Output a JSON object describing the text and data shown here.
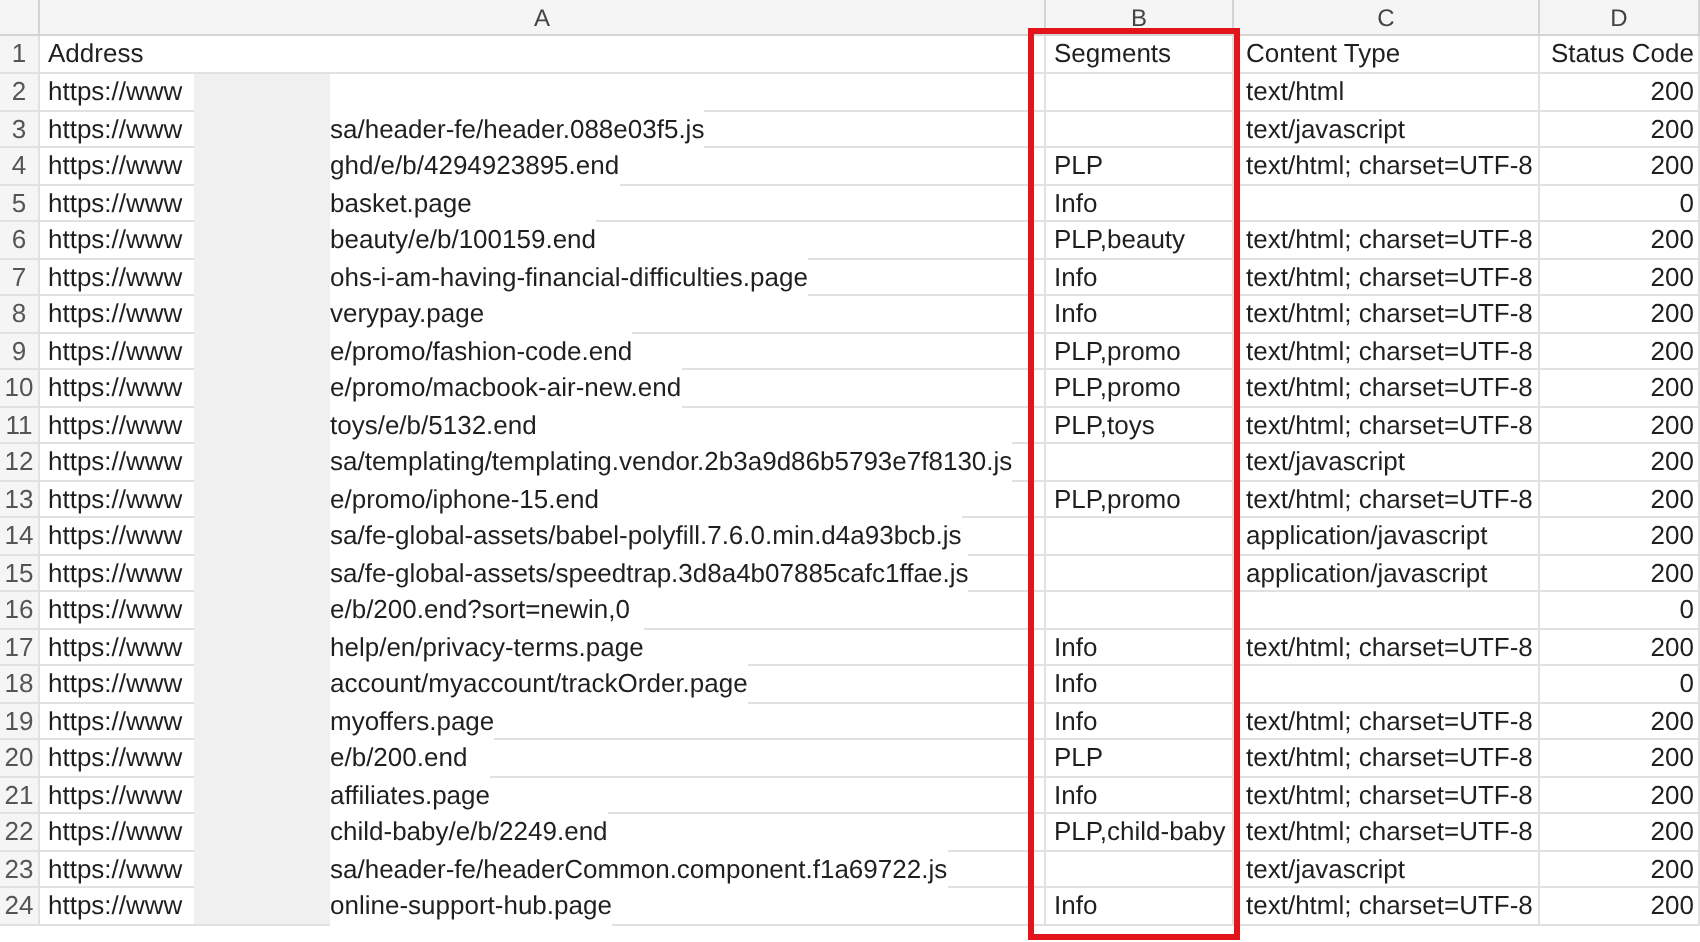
{
  "columns": [
    "A",
    "B",
    "C",
    "D"
  ],
  "header_row": {
    "row_number": "1",
    "address": "Address",
    "segments": "Segments",
    "content_type": "Content Type",
    "status_code": "Status Code"
  },
  "rows": [
    {
      "row_number": "2",
      "address_prefix": "https://www",
      "content_type": "text/html",
      "status_code": "200"
    },
    {
      "row_number": "3",
      "address_prefix": "https://www",
      "address_path": "sa/header-fe/header.088e03f5.js",
      "content_type": "text/javascript",
      "status_code": "200"
    },
    {
      "row_number": "4",
      "address_prefix": "https://www",
      "address_path": "ghd/e/b/4294923895.end",
      "segments": "PLP",
      "content_type": "text/html; charset=UTF-8",
      "status_code": "200"
    },
    {
      "row_number": "5",
      "address_prefix": "https://www",
      "address_path": "basket.page",
      "segments": "Info",
      "status_code": "0"
    },
    {
      "row_number": "6",
      "address_prefix": "https://www",
      "address_path": "beauty/e/b/100159.end",
      "segments": "PLP,beauty",
      "content_type": "text/html; charset=UTF-8",
      "status_code": "200"
    },
    {
      "row_number": "7",
      "address_prefix": "https://www",
      "address_path": "ohs-i-am-having-financial-difficulties.page",
      "segments": "Info",
      "content_type": "text/html; charset=UTF-8",
      "status_code": "200"
    },
    {
      "row_number": "8",
      "address_prefix": "https://www",
      "address_path": "verypay.page",
      "segments": "Info",
      "content_type": "text/html; charset=UTF-8",
      "status_code": "200"
    },
    {
      "row_number": "9",
      "address_prefix": "https://www",
      "address_path": "e/promo/fashion-code.end",
      "segments": "PLP,promo",
      "content_type": "text/html; charset=UTF-8",
      "status_code": "200"
    },
    {
      "row_number": "10",
      "address_prefix": "https://www",
      "address_path": "e/promo/macbook-air-new.end",
      "segments": "PLP,promo",
      "content_type": "text/html; charset=UTF-8",
      "status_code": "200"
    },
    {
      "row_number": "11",
      "address_prefix": "https://www",
      "address_path": "toys/e/b/5132.end",
      "segments": "PLP,toys",
      "content_type": "text/html; charset=UTF-8",
      "status_code": "200"
    },
    {
      "row_number": "12",
      "address_prefix": "https://www",
      "address_path": "sa/templating/templating.vendor.2b3a9d86b5793e7f8130.js",
      "content_type": "text/javascript",
      "status_code": "200"
    },
    {
      "row_number": "13",
      "address_prefix": "https://www",
      "address_path": "e/promo/iphone-15.end",
      "segments": "PLP,promo",
      "content_type": "text/html; charset=UTF-8",
      "status_code": "200"
    },
    {
      "row_number": "14",
      "address_prefix": "https://www",
      "address_path": "sa/fe-global-assets/babel-polyfill.7.6.0.min.d4a93bcb.js",
      "content_type": "application/javascript",
      "status_code": "200"
    },
    {
      "row_number": "15",
      "address_prefix": "https://www",
      "address_path": "sa/fe-global-assets/speedtrap.3d8a4b07885cafc1ffae.js",
      "content_type": "application/javascript",
      "status_code": "200"
    },
    {
      "row_number": "16",
      "address_prefix": "https://www",
      "address_path": "e/b/200.end?sort=newin,0",
      "status_code": "0"
    },
    {
      "row_number": "17",
      "address_prefix": "https://www",
      "address_path": "help/en/privacy-terms.page",
      "segments": "Info",
      "content_type": "text/html; charset=UTF-8",
      "status_code": "200"
    },
    {
      "row_number": "18",
      "address_prefix": "https://www",
      "address_path": "account/myaccount/trackOrder.page",
      "segments": "Info",
      "status_code": "0"
    },
    {
      "row_number": "19",
      "address_prefix": "https://www",
      "address_path": "myoffers.page",
      "segments": "Info",
      "content_type": "text/html; charset=UTF-8",
      "status_code": "200"
    },
    {
      "row_number": "20",
      "address_prefix": "https://www",
      "address_path": "e/b/200.end",
      "segments": "PLP",
      "content_type": "text/html; charset=UTF-8",
      "status_code": "200"
    },
    {
      "row_number": "21",
      "address_prefix": "https://www",
      "address_path": "affiliates.page",
      "segments": "Info",
      "content_type": "text/html; charset=UTF-8",
      "status_code": "200"
    },
    {
      "row_number": "22",
      "address_prefix": "https://www",
      "address_path": "child-baby/e/b/2249.end",
      "segments": "PLP,child-baby",
      "content_type": "text/html; charset=UTF-8",
      "status_code": "200"
    },
    {
      "row_number": "23",
      "address_prefix": "https://www",
      "address_path": "sa/header-fe/headerCommon.component.f1a69722.js",
      "content_type": "text/javascript",
      "status_code": "200"
    },
    {
      "row_number": "24",
      "address_prefix": "https://www",
      "address_path": "online-support-hub.page",
      "segments": "Info",
      "content_type": "text/html; charset=UTF-8",
      "status_code": "200"
    }
  ]
}
